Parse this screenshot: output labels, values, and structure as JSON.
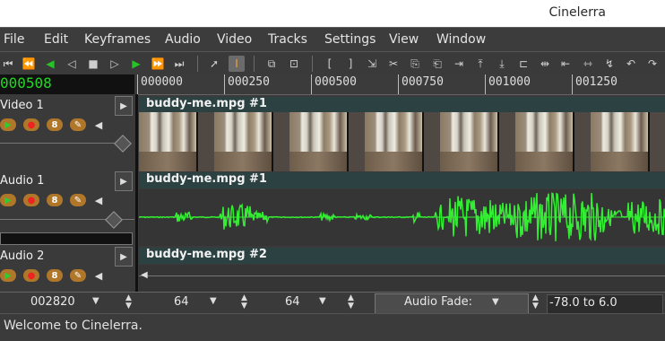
{
  "window": {
    "title": "Cinelerra"
  },
  "menu": [
    "File",
    "Edit",
    "Keyframes",
    "Audio",
    "Video",
    "Tracks",
    "Settings",
    "View",
    "Window"
  ],
  "toolbar": {
    "transport_icons": [
      "rewind-to-start-icon",
      "fast-rewind-icon",
      "reverse-play-icon",
      "frame-back-icon",
      "stop-icon",
      "frame-forward-icon",
      "play-icon",
      "fast-forward-icon",
      "goto-end-icon"
    ],
    "edit_icons": [
      "arrow-select-icon",
      "ibeam-select-icon",
      "copy-keyframes-icon",
      "paste-keyframes-icon",
      "in-point-icon",
      "out-point-icon",
      "splice-icon",
      "cut-icon",
      "copy-icon",
      "paste-icon",
      "overwrite-icon",
      "lift-icon",
      "extract-icon",
      "label-icon",
      "fit-icon",
      "align-left-icon",
      "align-right-icon",
      "zoom-icon",
      "title-safe-icon",
      "undo-icon",
      "redo-icon",
      "tool-icon"
    ]
  },
  "clock": {
    "value": "000508"
  },
  "ruler": {
    "labels": [
      "000000",
      "000250",
      "000500",
      "000750",
      "001000",
      "001250"
    ]
  },
  "tracks": [
    {
      "name": "Video 1",
      "edit_title": "buddy-me.mpg #1",
      "type": "video"
    },
    {
      "name": "Audio 1",
      "edit_title": "buddy-me.mpg #1",
      "type": "audio"
    },
    {
      "name": "Audio 2",
      "edit_title": "buddy-me.mpg #2",
      "type": "audio"
    }
  ],
  "patch_buttons": {
    "play": "▶",
    "record": "●",
    "gang": "8",
    "draw": "✎",
    "mute": "◀"
  },
  "bottom": {
    "position": "002820",
    "zoom_sample": "64",
    "zoom_amp": "64",
    "fade_label": "Audio Fade:",
    "range": "-78.0 to 6.0"
  },
  "status": {
    "message": "Welcome to Cinelerra."
  },
  "colors": {
    "waveform": "#33ee33",
    "clock": "#22d822",
    "edit_header": "#2c4141"
  }
}
